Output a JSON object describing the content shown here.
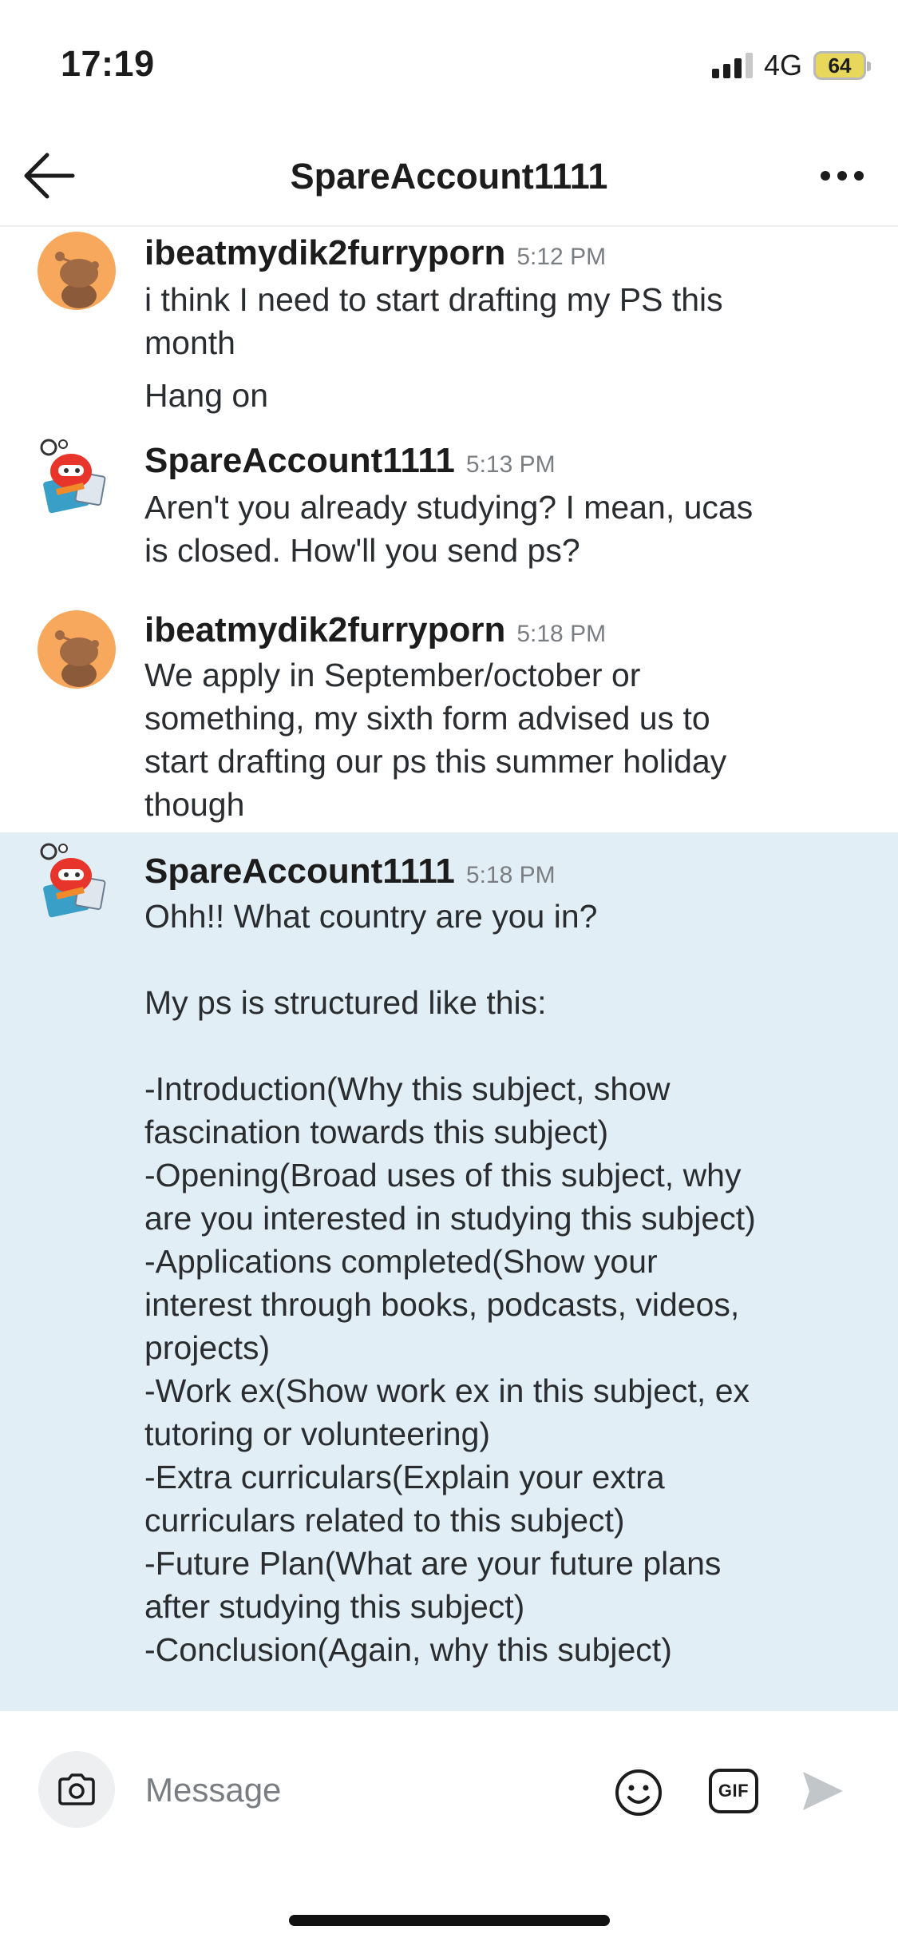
{
  "status_bar": {
    "time": "17:19",
    "network": "4G",
    "battery": "64"
  },
  "header": {
    "title": "SpareAccount1111",
    "back_icon": "arrow-left-icon",
    "more_icon": "more-horizontal-icon"
  },
  "messages": [
    {
      "username": "ibeatmydik2furryporn",
      "time": "5:12 PM",
      "avatar": "snoo-orange-avatar",
      "lines": [
        "i think I need to start drafting my PS this\nmonth",
        "Hang on"
      ]
    },
    {
      "username": "SpareAccount1111",
      "time": "5:13 PM",
      "avatar": "snoo-robot-avatar",
      "lines": [
        "Aren't you already studying? I mean, ucas\nis closed. How'll you send ps?"
      ]
    },
    {
      "username": "ibeatmydik2furryporn",
      "time": "5:18 PM",
      "avatar": "snoo-orange-avatar",
      "lines": [
        "We apply in September/october or\nsomething, my sixth form advised us to\nstart drafting our ps this summer holiday\nthough"
      ]
    },
    {
      "username": "SpareAccount1111",
      "time": "5:18 PM",
      "avatar": "snoo-robot-avatar",
      "highlighted": true,
      "lines": [
        "Ohh!! What country are you in?\n\nMy ps is structured like this:\n\n-Introduction(Why this subject, show\nfascination towards this subject)\n-Opening(Broad uses of this subject, why\nare you interested in studying this subject)\n-Applications completed(Show your\ninterest through books, podcasts, videos,\nprojects)\n-Work ex(Show work ex in this subject, ex\ntutoring or volunteering)\n-Extra curriculars(Explain your extra\ncurriculars related to this subject)\n-Future Plan(What are your future plans\nafter studying this subject)\n-Conclusion(Again, why this subject)"
      ]
    }
  ],
  "composer": {
    "placeholder": "Message",
    "camera_icon": "camera-icon",
    "emoji_icon": "emoji-icon",
    "gif_label": "GIF",
    "send_icon": "send-icon"
  },
  "colors": {
    "highlight_bg": "#e2eef5",
    "avatar_orange": "#f7a85c",
    "robot_red": "#e8352b"
  }
}
